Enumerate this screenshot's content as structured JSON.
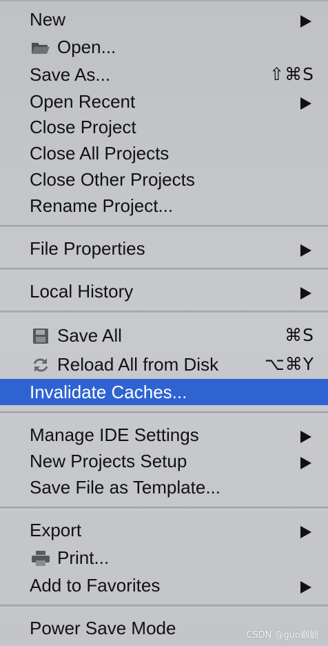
{
  "menu": {
    "items": [
      {
        "label": "New"
      },
      {
        "label": "Open..."
      },
      {
        "label": "Save As...",
        "shortcut": "⇧⌘S"
      },
      {
        "label": "Open Recent"
      },
      {
        "label": "Close Project"
      },
      {
        "label": "Close All Projects"
      },
      {
        "label": "Close Other Projects"
      },
      {
        "label": "Rename Project..."
      },
      {
        "label": "File Properties"
      },
      {
        "label": "Local History"
      },
      {
        "label": "Save All",
        "shortcut": "⌘S"
      },
      {
        "label": "Reload All from Disk",
        "shortcut": "⌥⌘Y"
      },
      {
        "label": "Invalidate Caches..."
      },
      {
        "label": "Manage IDE Settings"
      },
      {
        "label": "New Projects Setup"
      },
      {
        "label": "Save File as Template..."
      },
      {
        "label": "Export"
      },
      {
        "label": "Print..."
      },
      {
        "label": "Add to Favorites"
      },
      {
        "label": "Power Save Mode"
      }
    ]
  },
  "icons": {
    "open": "folder-icon",
    "save_all": "floppy-disk-icon",
    "reload": "reload-icon",
    "print": "printer-icon"
  },
  "colors": {
    "selection": "#2f63d2",
    "menu_background": "#c4c6c9",
    "text": "#111111"
  },
  "watermark": "CSDN @guo蝈蝈"
}
